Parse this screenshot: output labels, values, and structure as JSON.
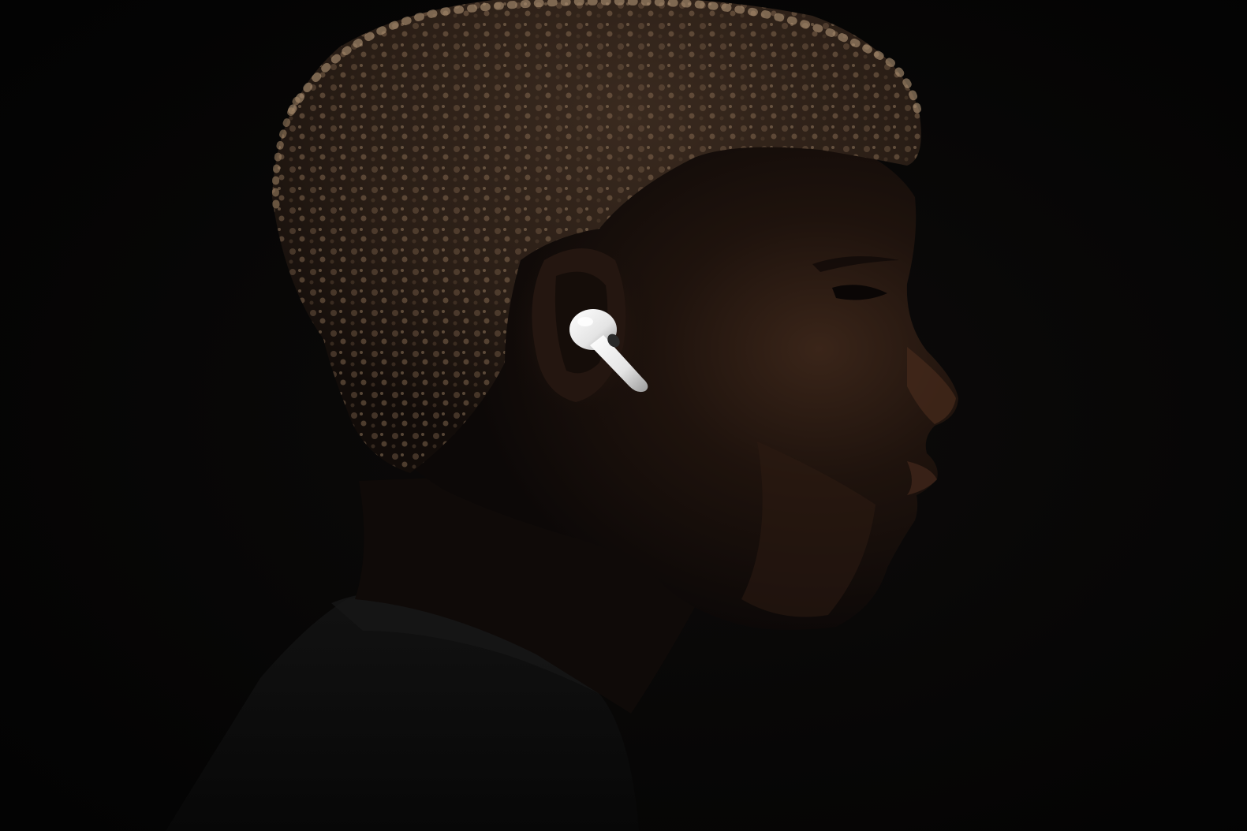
{
  "scene": {
    "subject": "person-profile-with-earbud",
    "colors": {
      "background": "#050505",
      "skin": "#1a100c",
      "hair": "#5a4533",
      "hair_highlight": "#b29676",
      "shirt": "#0b0b0b",
      "earbud": "#e9e9e9"
    },
    "icons": {
      "earbud": "wireless-earbud-icon"
    }
  }
}
